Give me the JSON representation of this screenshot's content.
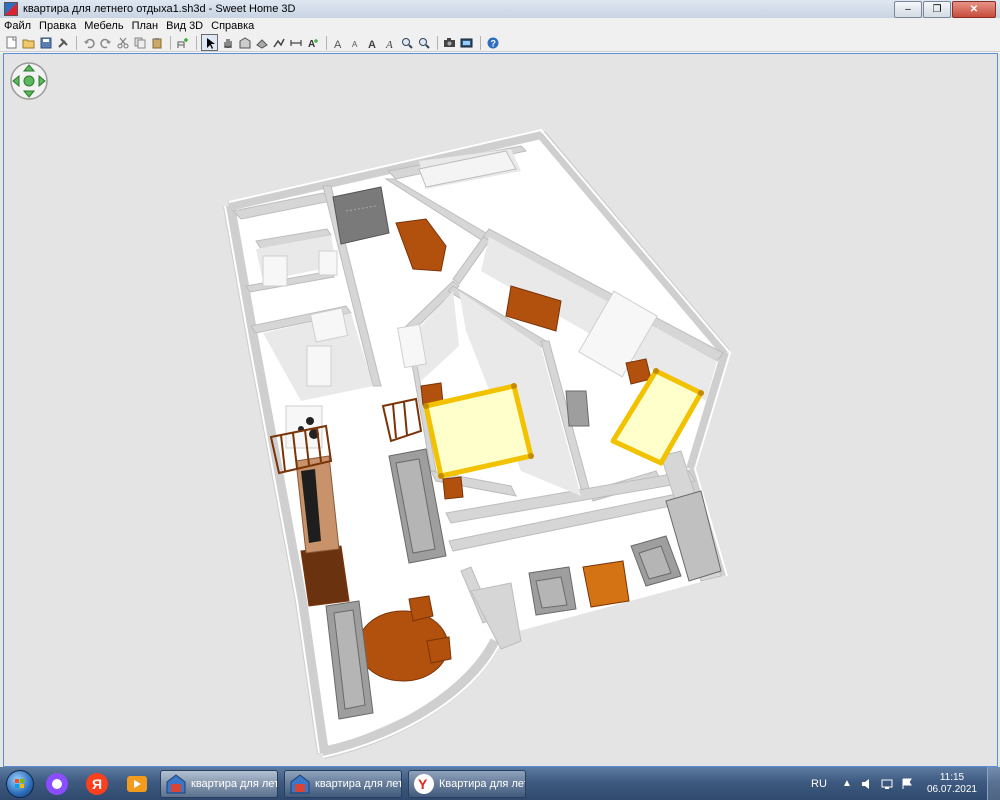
{
  "window": {
    "title": "квартира для летнего отдыха1.sh3d - Sweet Home 3D",
    "minimize_glyph": "–",
    "maximize_glyph": "❐",
    "close_glyph": "✕"
  },
  "menu": [
    "Файл",
    "Правка",
    "Мебель",
    "План",
    "Вид 3D",
    "Справка"
  ],
  "toolbar": {
    "groups": [
      [
        "new-home-icon",
        "open-icon",
        "save-icon",
        "preferences-icon"
      ],
      [
        "undo-icon",
        "redo-icon",
        "cut-icon",
        "copy-icon",
        "paste-icon"
      ],
      [
        "add-furniture-icon"
      ],
      [
        "select-mode-icon",
        "pan-mode-icon",
        "create-walls-icon",
        "create-rooms-icon",
        "create-polylines-icon",
        "create-dimensions-icon",
        "create-labels-icon"
      ],
      [
        "increase-text-icon",
        "decrease-text-icon",
        "bold-text-icon",
        "italic-text-icon",
        "zoom-in-icon",
        "zoom-out-icon"
      ],
      [
        "create-photo-icon",
        "create-video-icon"
      ],
      [
        "help-icon"
      ]
    ],
    "selected": "select-mode-icon"
  },
  "viewer": {
    "navigator": "navigation-arrows",
    "colors": {
      "background": "#e4e4e4",
      "floor": "#ffffff",
      "wall": "#d2d2d2",
      "wood": "#b2500d",
      "bed": "#ffffcc",
      "bed_frame": "#f2c200",
      "sofa": "#9e9e9e"
    }
  },
  "taskbar": {
    "buttons": [
      {
        "label": "квартира для лет...",
        "icon": "sweet-home-3d-icon",
        "active": true
      },
      {
        "label": "квартира для лет...",
        "icon": "sweet-home-3d-icon",
        "active": false
      },
      {
        "label": "Квартира для лет...",
        "icon": "yandex-browser-icon",
        "active": false
      }
    ],
    "quick_launch": [
      "alice-assistant-icon",
      "yandex-icon",
      "media-player-icon"
    ],
    "language": "RU",
    "time": "11:15",
    "date": "06.07.2021"
  }
}
